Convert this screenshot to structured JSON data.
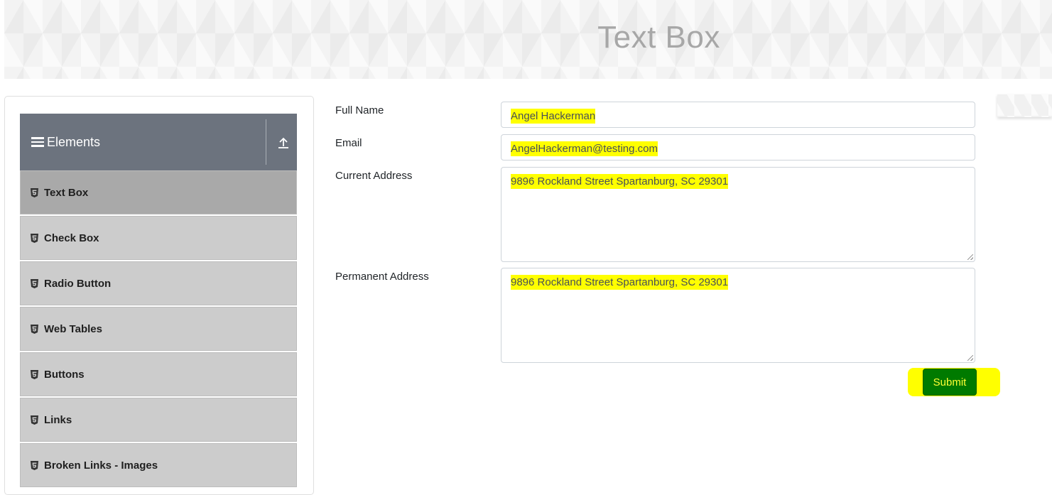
{
  "header": {
    "title": "Text Box"
  },
  "sidebar": {
    "group_title": "Elements",
    "items": [
      {
        "label": "Text Box",
        "active": true
      },
      {
        "label": "Check Box"
      },
      {
        "label": "Radio Button"
      },
      {
        "label": "Web Tables"
      },
      {
        "label": "Buttons"
      },
      {
        "label": "Links"
      },
      {
        "label": "Broken Links - Images"
      }
    ]
  },
  "form": {
    "full_name": {
      "label": "Full Name",
      "value": "Angel Hackerman"
    },
    "email": {
      "label": "Email",
      "value": "AngelHackerman@testing.com"
    },
    "current_address": {
      "label": "Current Address",
      "value": "9896 Rockland Street Spartanburg, SC 29301"
    },
    "permanent_address": {
      "label": "Permanent Address",
      "value": "9896 Rockland Street Spartanburg, SC 29301"
    },
    "submit_label": "Submit"
  },
  "colors": {
    "header_bg": "#6c737e",
    "menu_item_bg": "#cccccc",
    "menu_item_active_bg": "#a9a9a9",
    "highlight": "#ffff00",
    "submit_bg": "#007a00"
  },
  "icons": {
    "group_icon": "hamburger-icon",
    "collapse_icon": "upload-icon",
    "item_icon": "html5-icon"
  }
}
